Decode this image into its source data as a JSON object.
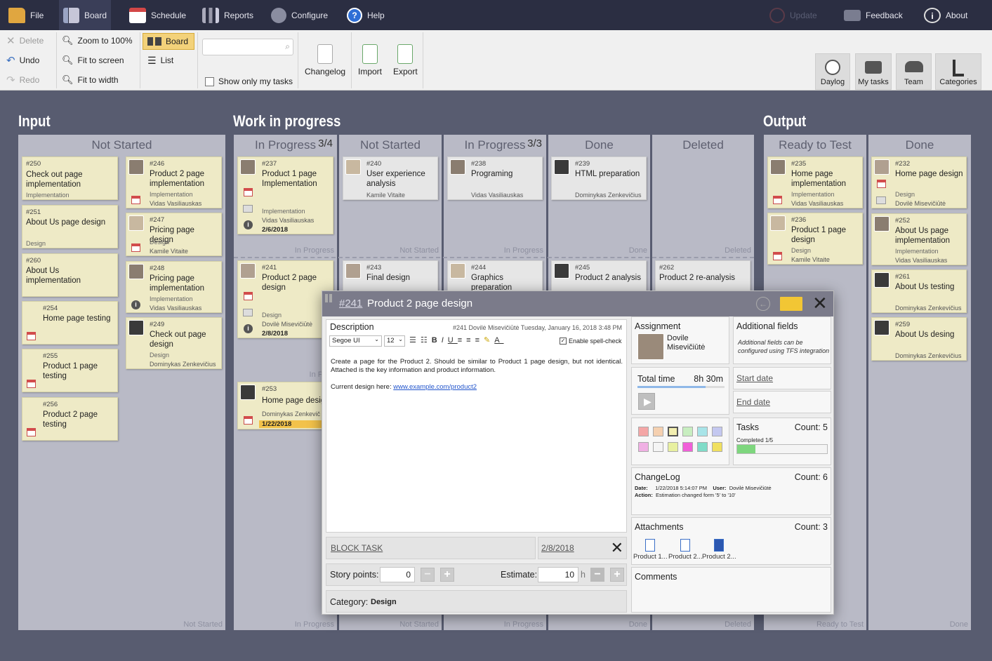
{
  "topbar": {
    "items": [
      {
        "label": "File",
        "icon": "folder-icon"
      },
      {
        "label": "Board",
        "icon": "board-icon",
        "active": true
      },
      {
        "label": "Schedule",
        "icon": "calendar-icon"
      },
      {
        "label": "Reports",
        "icon": "reports-icon"
      },
      {
        "label": "Configure",
        "icon": "gear-icon"
      },
      {
        "label": "Help",
        "icon": "help-icon"
      }
    ],
    "right": [
      {
        "label": "Update",
        "icon": "update-icon",
        "disabled": true
      },
      {
        "label": "Feedback",
        "icon": "feedback-icon"
      },
      {
        "label": "About",
        "icon": "info-icon"
      }
    ]
  },
  "ribbon": {
    "delete": "Delete",
    "undo": "Undo",
    "redo": "Redo",
    "zoom100": "Zoom to 100%",
    "fit_screen": "Fit to screen",
    "fit_width": "Fit to width",
    "view_board": "Board",
    "view_list": "List",
    "search_placeholder": "",
    "show_only_my_tasks": "Show only my tasks",
    "changelog": "Changelog",
    "import": "Import",
    "export": "Export",
    "tiles": [
      "Daylog",
      "My tasks",
      "Team",
      "Categories"
    ]
  },
  "board": {
    "sections": {
      "input": "Input",
      "wip": "Work in progress",
      "output": "Output"
    },
    "columns": [
      {
        "title": "Not Started",
        "foot": "Not Started"
      },
      {
        "title": "In Progress",
        "wip": "3/4",
        "foot": "In Progress",
        "lane_label": "In Progress",
        "lane_label2": "In Prog"
      },
      {
        "title": "Not Started",
        "foot": "Not Started",
        "lane_label": "Not Started"
      },
      {
        "title": "In Progress",
        "wip": "3/3",
        "foot": "In Progress",
        "lane_label": "In Progress"
      },
      {
        "title": "Done",
        "foot": "Done",
        "lane_label": "Done"
      },
      {
        "title": "Deleted",
        "foot": "Deleted",
        "lane_label": "Deleted"
      },
      {
        "title": "Ready to Test",
        "foot": "Ready to Test"
      },
      {
        "title": "Done",
        "foot": "Done"
      }
    ],
    "cards": {
      "c250": {
        "num": "#250",
        "title": "Check out page implementation",
        "cat": "Implementation"
      },
      "c251": {
        "num": "#251",
        "title": "About Us page design",
        "cat": "Design"
      },
      "c260": {
        "num": "#260",
        "title": "About Us implementation"
      },
      "c254": {
        "num": "#254",
        "title": "Home page testing"
      },
      "c255": {
        "num": "#255",
        "title": "Product 1 page testing"
      },
      "c256": {
        "num": "#256",
        "title": "Product 2 page testing"
      },
      "c246": {
        "num": "#246",
        "title": "Product 2 page implementation",
        "cat": "Implementation",
        "who": "Vidas Vasiliauskas"
      },
      "c247": {
        "num": "#247",
        "title": "Pricing page design",
        "cat": "Design",
        "who": "Kamile Vitaite"
      },
      "c248": {
        "num": "#248",
        "title": "Pricing page implementation",
        "cat": "Implementation",
        "who": "Vidas Vasiliauskas"
      },
      "c249": {
        "num": "#249",
        "title": "Check out page design",
        "cat": "Design",
        "who": "Dominykas Zenkevičius"
      },
      "c237": {
        "num": "#237",
        "title": "Product 1 page Implementation",
        "cat": "Implementation",
        "who": "Vidas Vasiliauskas",
        "due": "2/6/2018"
      },
      "c241": {
        "num": "#241",
        "title": "Product 2 page design",
        "cat": "Design",
        "who": "Dovilė Misevičiūtė",
        "due": "2/8/2018"
      },
      "c253": {
        "num": "#253",
        "title": "Home page desig",
        "who": "Dominykas Zenkevič",
        "due": "1/22/2018"
      },
      "c240": {
        "num": "#240",
        "title": "User experience analysis",
        "who": "Kamile Vitaite"
      },
      "c243": {
        "num": "#243",
        "title": "Final design"
      },
      "c238": {
        "num": "#238",
        "title": "Programing",
        "who": "Vidas Vasiliauskas"
      },
      "c244": {
        "num": "#244",
        "title": "Graphics preparation"
      },
      "c239": {
        "num": "#239",
        "title": "HTML preparation",
        "who": "Dominykas Zenkevičius"
      },
      "c245": {
        "num": "#245",
        "title": "Product 2 analysis"
      },
      "c262": {
        "num": "#262",
        "title": "Product 2 re-analysis"
      },
      "c235": {
        "num": "#235",
        "title": "Home page implementation",
        "cat": "Implementation",
        "who": "Vidas Vasiliauskas"
      },
      "c236": {
        "num": "#236",
        "title": "Product 1 page design",
        "cat": "Design",
        "who": "Kamile Vitaite"
      },
      "c232": {
        "num": "#232",
        "title": "Home page design",
        "cat": "Design",
        "who": "Dovilė Misevičiūtė"
      },
      "c252": {
        "num": "#252",
        "title": "About Us page implementation",
        "cat": "Implementation",
        "who": "Vidas Vasiliauskas"
      },
      "c261": {
        "num": "#261",
        "title": "About Us testing",
        "who": "Dominykas Zenkevičius"
      },
      "c259": {
        "num": "#259",
        "title": "About Us desing",
        "who": "Dominykas Zenkevičius"
      }
    }
  },
  "dialog": {
    "task_num": "#241",
    "title": "Product 2 page design",
    "description": {
      "label": "Description",
      "meta": "#241  Dovilė Misevičiūtė  Tuesday, January 16, 2018 3:48 PM",
      "font": "Segoe UI",
      "size": "12",
      "spellcheck": "Enable spell-check",
      "text1": "Create a page for the Product 2. Should be similar to Product 1 page design, but not identical. Attached is the key information and product information.",
      "text2_prefix": "Current design here: ",
      "link": "www.example.com/product2"
    },
    "block_task": "BLOCK TASK",
    "block_date": "2/8/2018",
    "story_points_label": "Story points:",
    "story_points": "0",
    "estimate_label": "Estimate:",
    "estimate": "10",
    "estimate_unit": "h",
    "category_label": "Category:",
    "category": "Design",
    "assignment": {
      "label": "Assignment",
      "name": "Dovile Misevičiūtė"
    },
    "additional": {
      "label": "Additional fields",
      "note": "Additional fields can be configured using TFS integration"
    },
    "total_time": {
      "label": "Total time",
      "value": "8h 30m",
      "progress": 0.78
    },
    "start_date": "Start date",
    "end_date": "End date",
    "colors": [
      "#f4a6a6",
      "#f5d0b0",
      "#f2eeb0",
      "#c8eec0",
      "#a8e4e8",
      "#c4c8f0",
      "#f0b0e4",
      "#f4f4f4",
      "#e8f0a0",
      "#f060d8",
      "#80dcc8",
      "#f0e060"
    ],
    "tasks": {
      "label": "Tasks",
      "count": "Count: 5",
      "completed": "Completed  1/5",
      "progress": 0.2
    },
    "changelog": {
      "label": "ChangeLog",
      "count": "Count: 6",
      "date_label": "Date:",
      "date": "1/22/2018 5:14:07 PM",
      "user_label": "User:",
      "user": "Dovilė Misevičiūtė",
      "action_label": "Action:",
      "action": "Estimation changed form '5' to '10'"
    },
    "attachments": {
      "label": "Attachments",
      "count": "Count: 3",
      "files": [
        "Product 1...",
        "Product 2...",
        "Product 2..."
      ]
    },
    "comments": "Comments"
  }
}
